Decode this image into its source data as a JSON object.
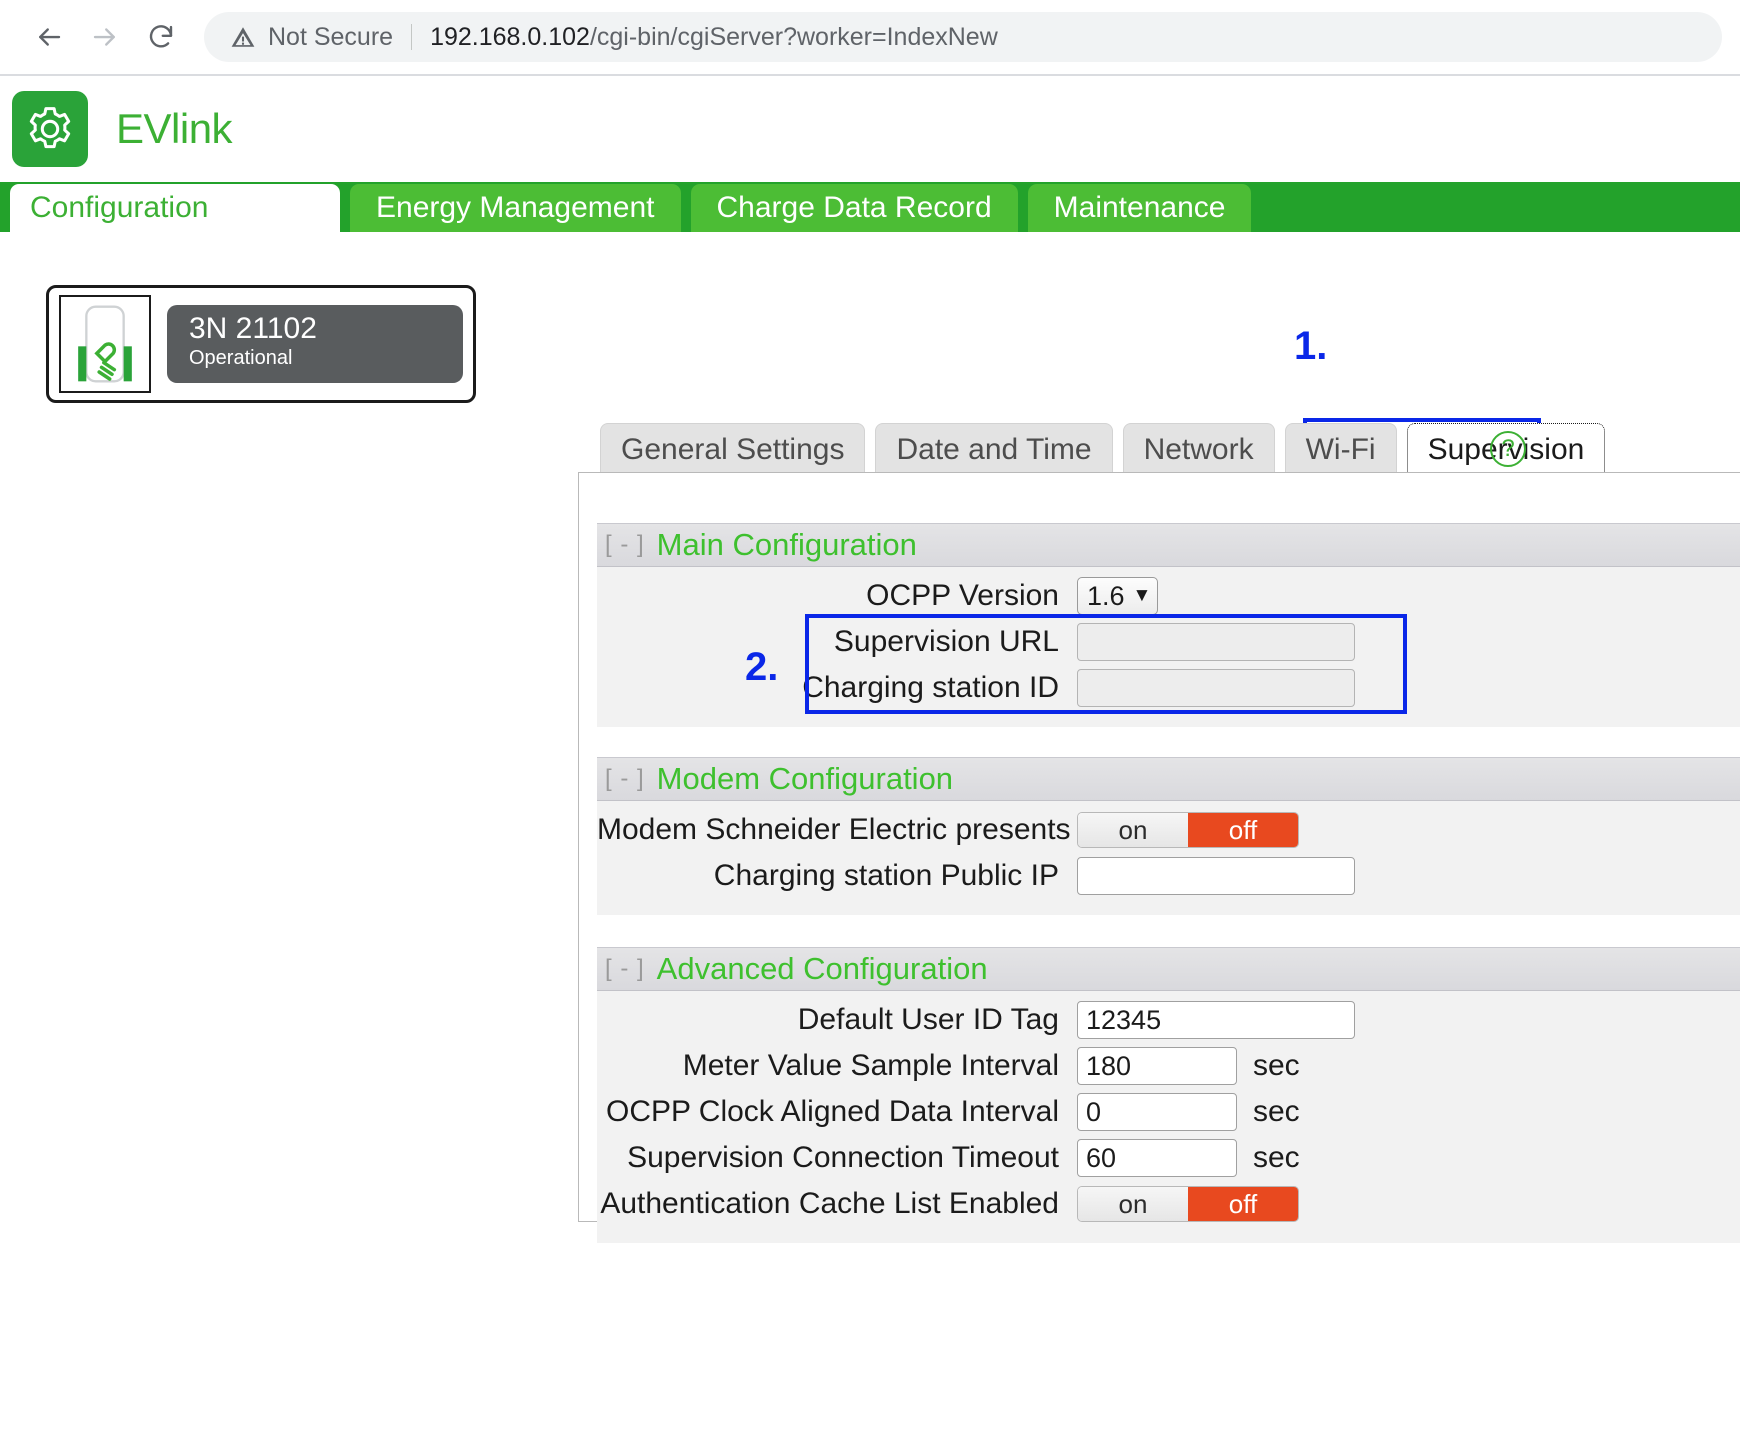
{
  "browser": {
    "back_icon": "back-arrow-icon",
    "forward_icon": "forward-arrow-icon",
    "reload_icon": "reload-icon",
    "security_label": "Not Secure",
    "url_host": "192.168.0.102",
    "url_path": "/cgi-bin/cgiServer?worker=IndexNew"
  },
  "app": {
    "brand": "EVlink",
    "logo_icon": "gear-icon",
    "accent_green": "#3cb034",
    "nav_bar_green": "#23a22b",
    "annotation_blue": "#0a27e8",
    "toggle_active_red": "#e8491f"
  },
  "main_tabs": [
    {
      "label": "Configuration",
      "active": true
    },
    {
      "label": "Energy Management",
      "active": false
    },
    {
      "label": "Charge Data Record",
      "active": false
    },
    {
      "label": "Maintenance",
      "active": false
    }
  ],
  "station_card": {
    "name": "3N 21102",
    "status": "Operational",
    "thumb_icon": "charging-station-icon"
  },
  "annotations": [
    {
      "id": "1",
      "label": "1."
    },
    {
      "id": "2",
      "label": "2."
    }
  ],
  "sub_tabs": [
    {
      "label": "General Settings",
      "selected": false
    },
    {
      "label": "Date and Time",
      "selected": false
    },
    {
      "label": "Network",
      "selected": false
    },
    {
      "label": "Wi-Fi",
      "selected": false
    },
    {
      "label": "Supervision",
      "selected": true
    }
  ],
  "help_icon_label": "?",
  "sections": {
    "main": {
      "toggle": "[ - ]",
      "title": "Main Configuration",
      "ocpp_version_label": "OCPP Version",
      "ocpp_version_value": "1.6",
      "ocpp_version_caret": "⌄",
      "supervision_url_label": "Supervision URL",
      "supervision_url_value": "",
      "charging_station_id_label": "Charging station ID",
      "charging_station_id_value": ""
    },
    "modem": {
      "toggle": "[ - ]",
      "title": "Modem Configuration",
      "modem_present_label": "Modem Schneider Electric presents",
      "modem_present_on": "on",
      "modem_present_off": "off",
      "modem_present_state": "off",
      "public_ip_label": "Charging station Public IP",
      "public_ip_value": ""
    },
    "advanced": {
      "toggle": "[ - ]",
      "title": "Advanced Configuration",
      "fields": [
        {
          "label": "Default User ID Tag",
          "value": "12345",
          "unit": ""
        },
        {
          "label": "Meter Value Sample Interval",
          "value": "180",
          "unit": "sec"
        },
        {
          "label": "OCPP Clock Aligned Data Interval",
          "value": "0",
          "unit": "sec"
        },
        {
          "label": "Supervision Connection Timeout",
          "value": "60",
          "unit": "sec"
        }
      ],
      "auth_cache_label": "Authentication Cache List Enabled",
      "auth_cache_on": "on",
      "auth_cache_off": "off",
      "auth_cache_state": "off"
    }
  }
}
